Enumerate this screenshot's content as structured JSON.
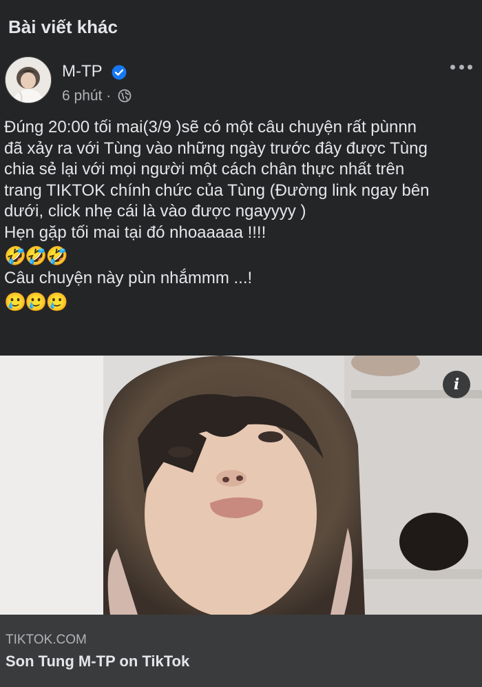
{
  "section": {
    "title": "Bài viết khác"
  },
  "post": {
    "author": "M-TP",
    "verified": true,
    "time": "6 phút",
    "separator": "·",
    "privacy_icon": "globe-icon",
    "more_icon": "more-horizontal-icon",
    "lines": [
      "Đúng 20:00 tối mai(3/9 )sẽ có một câu chuyện rất pùnnn",
      "đã xảy ra với Tùng vào những ngày trước đây được Tùng",
      "chia sẻ lại với mọi người một cách chân thực nhất trên",
      "trang TIKTOK chính chức của Tùng (Đường link ngay bên",
      "dưới, click nhẹ cái là vào được ngayyyy )",
      "Hẹn gặp tối mai tại đó nhoaaaaa !!!!"
    ],
    "emoji_row_1": "🤣🤣🤣",
    "line_after": "Câu chuyện này pùn nhắmmm ...!",
    "emoji_row_2": "🥲🥲🥲"
  },
  "media": {
    "info_icon": "info-icon",
    "info_label": "i"
  },
  "link": {
    "domain": "TIKTOK.COM",
    "title": "Son Tung M-TP on TikTok"
  },
  "colors": {
    "background": "#242526",
    "link_bar": "#3a3b3c",
    "verified": "#1877f2",
    "text": "#e4e6eb",
    "secondary": "#b0b3b8"
  }
}
